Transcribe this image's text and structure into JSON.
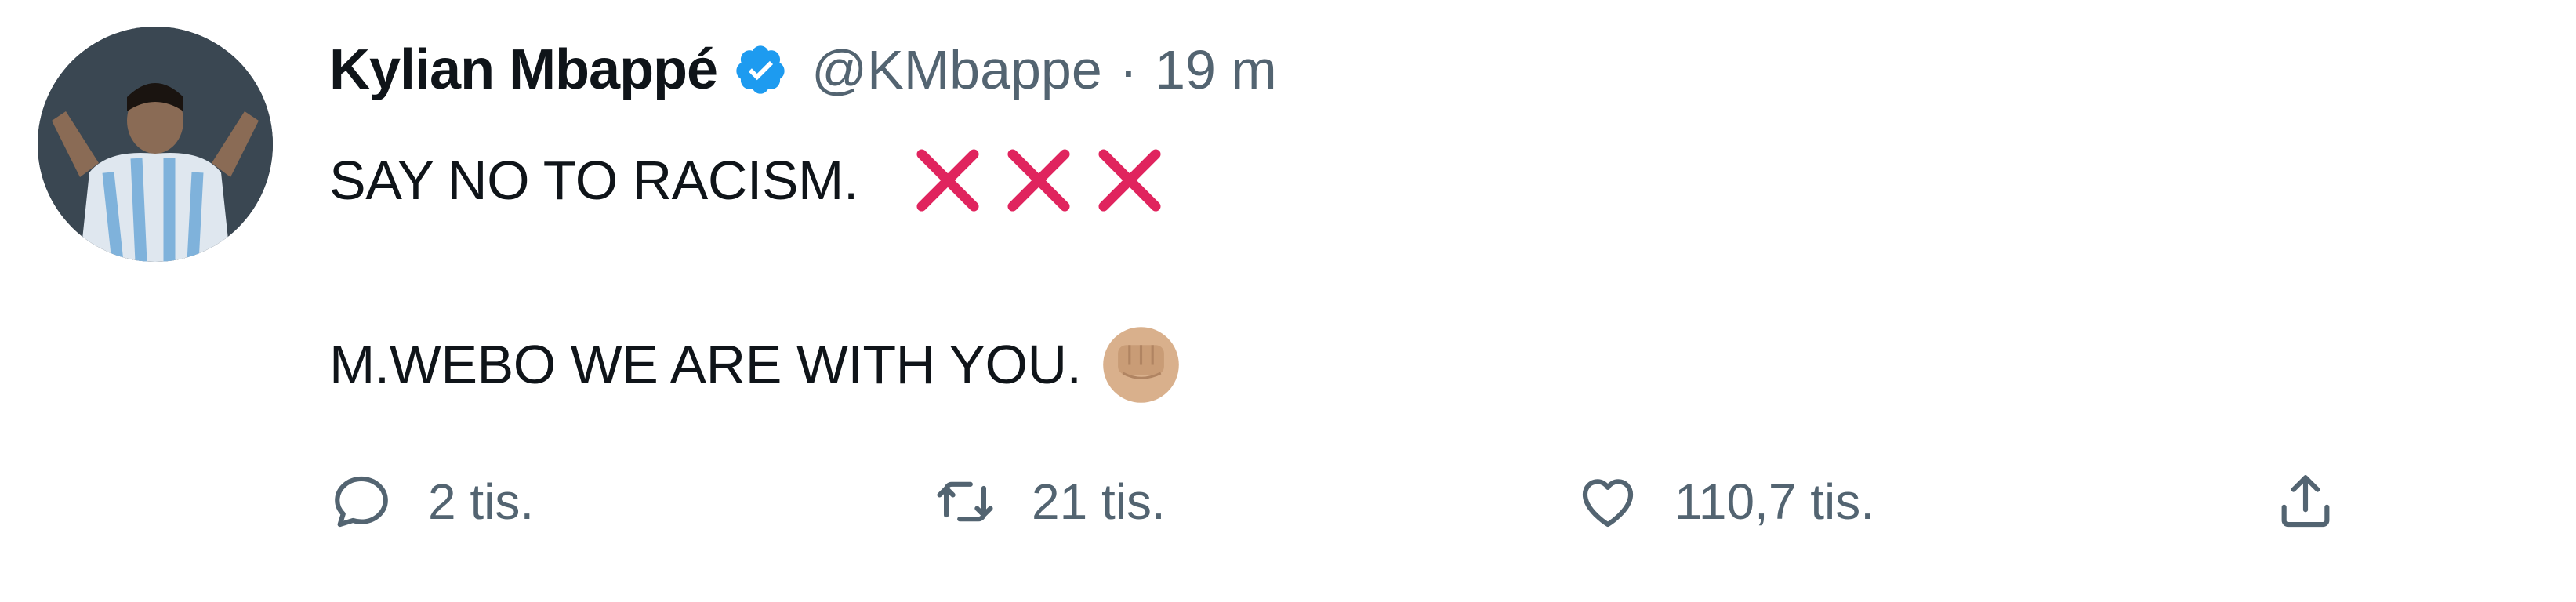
{
  "tweet": {
    "author": {
      "display_name": "Kylian Mbappé",
      "handle": "@KMbappe",
      "verified": true
    },
    "separator": "·",
    "time": "19 m",
    "text_line_1": "SAY NO TO RACISM.",
    "text_line_1_emoji": [
      "cross-mark-icon",
      "cross-mark-icon",
      "cross-mark-icon"
    ],
    "text_line_2": "M.WEBO WE ARE WITH YOU.",
    "text_line_2_emoji": "raised-fist-icon",
    "actions": {
      "reply_count": "2 tis.",
      "retweet_count": "21 tis.",
      "like_count": "110,7 tis."
    }
  },
  "colors": {
    "verified": "#1d9bf0",
    "cross_mark": "#e0245e",
    "secondary_text": "#536471",
    "primary_text": "#0f1419",
    "fist": "#d9b08c"
  }
}
